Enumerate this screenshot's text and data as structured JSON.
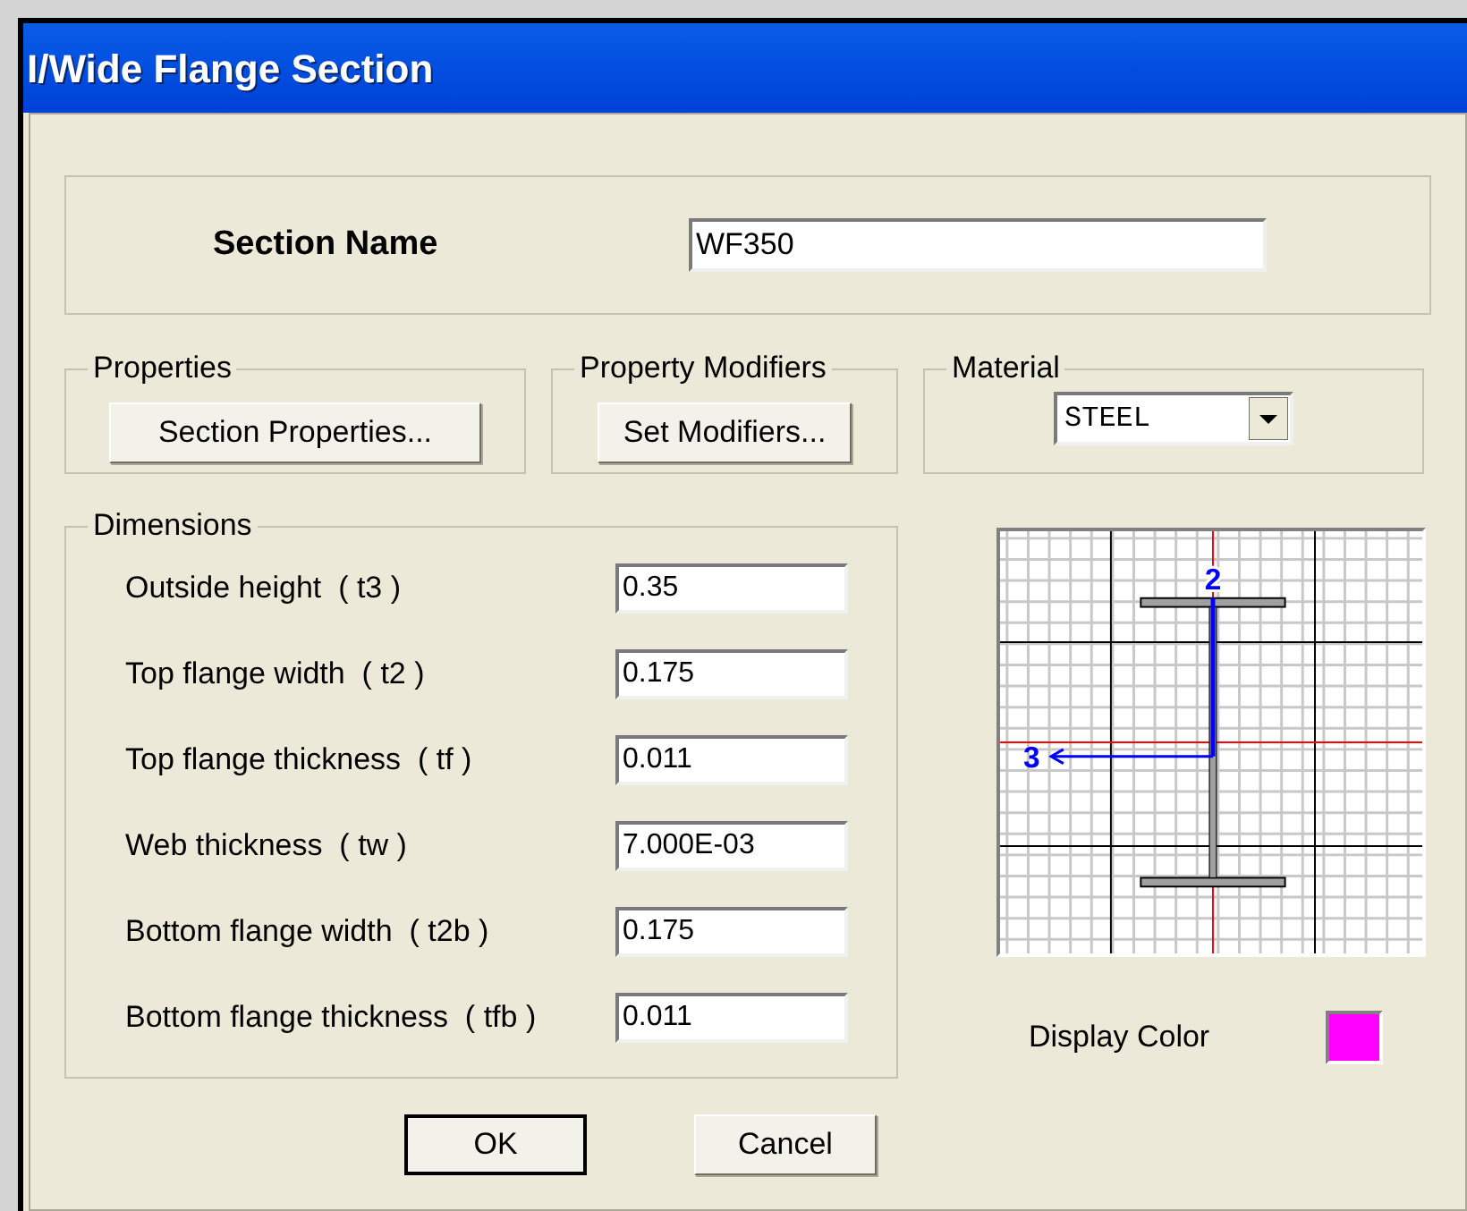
{
  "window": {
    "title": "I/Wide Flange Section"
  },
  "section_name": {
    "label": "Section Name",
    "value": "WF350"
  },
  "properties": {
    "label": "Properties",
    "button": "Section Properties..."
  },
  "property_modifiers": {
    "label": "Property Modifiers",
    "button": "Set Modifiers..."
  },
  "material": {
    "label": "Material",
    "value": "STEEL"
  },
  "dimensions": {
    "label": "Dimensions",
    "fields": [
      {
        "label": "Outside height  ( t3 )",
        "value": "0.35"
      },
      {
        "label": "Top flange width  ( t2 )",
        "value": "0.175"
      },
      {
        "label": "Top flange thickness  ( tf )",
        "value": "0.011"
      },
      {
        "label": "Web thickness  ( tw )",
        "value": "7.000E-03"
      },
      {
        "label": "Bottom flange width  ( t2b )",
        "value": "0.175"
      },
      {
        "label": "Bottom flange thickness  ( tfb )",
        "value": "0.011"
      }
    ]
  },
  "section_preview": {
    "axis_2": "2",
    "axis_3": "3"
  },
  "display_color": {
    "label": "Display Color",
    "color": "#ff00ff"
  },
  "buttons": [
    {
      "label": "OK",
      "default": true
    },
    {
      "label": "Cancel",
      "default": false
    }
  ]
}
